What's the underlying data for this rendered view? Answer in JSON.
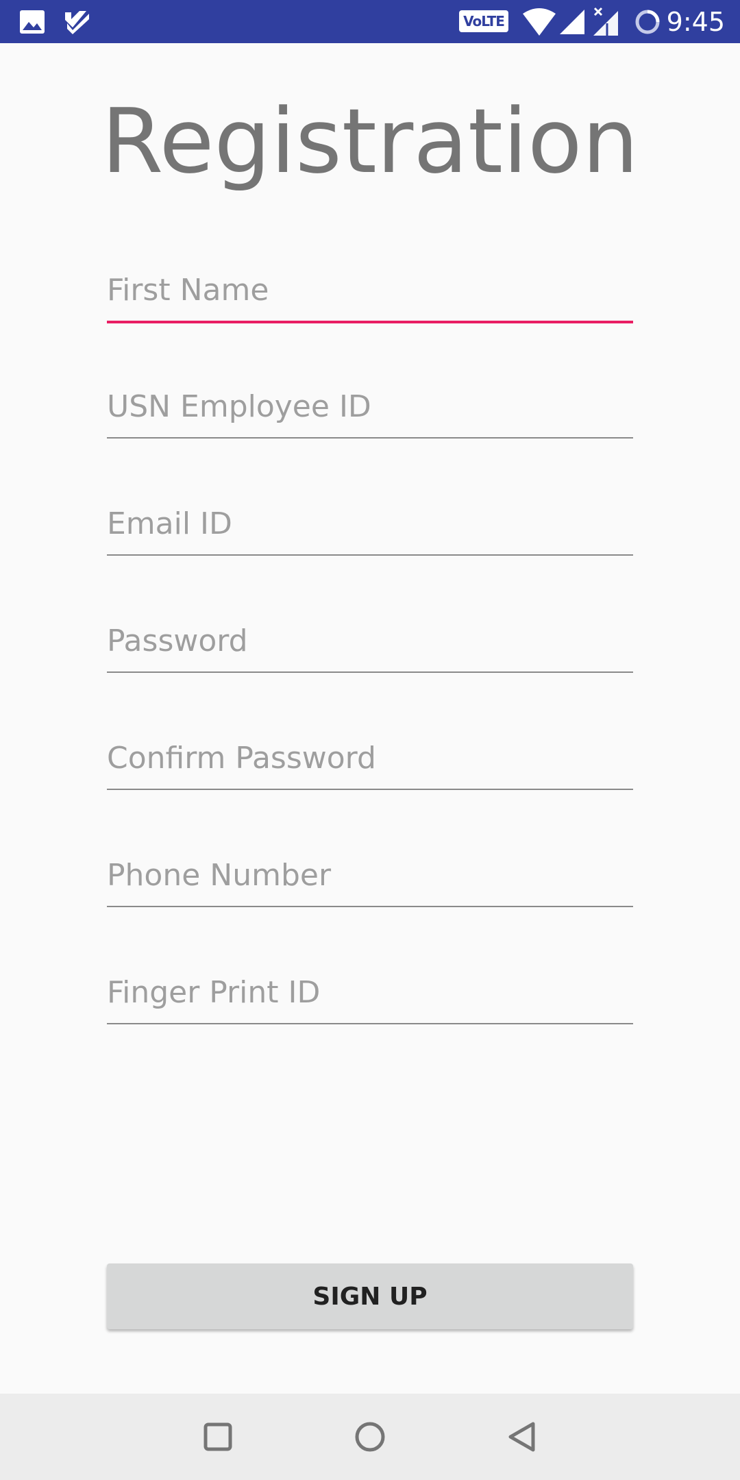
{
  "status_bar": {
    "time": "9:45",
    "volte_label": "VoLTE",
    "background": "#303f9f",
    "icons": [
      "image-icon",
      "check-task-icon",
      "wifi-icon",
      "signal-icon",
      "signal-off-icon",
      "sync-icon"
    ]
  },
  "form": {
    "title": "Registration",
    "fields": [
      {
        "placeholder": "First Name",
        "focused": true
      },
      {
        "placeholder": "USN Employee ID",
        "focused": false
      },
      {
        "placeholder": "Email ID",
        "focused": false
      },
      {
        "placeholder": "Password",
        "focused": false
      },
      {
        "placeholder": "Confirm Password",
        "focused": false
      },
      {
        "placeholder": "Phone Number",
        "focused": false
      },
      {
        "placeholder": "Finger Print ID",
        "focused": false
      }
    ],
    "submit_label": "SIGN UP",
    "accent_color": "#e91e63"
  },
  "nav_bar": {
    "buttons": [
      "recents-icon",
      "home-icon",
      "back-icon"
    ]
  }
}
